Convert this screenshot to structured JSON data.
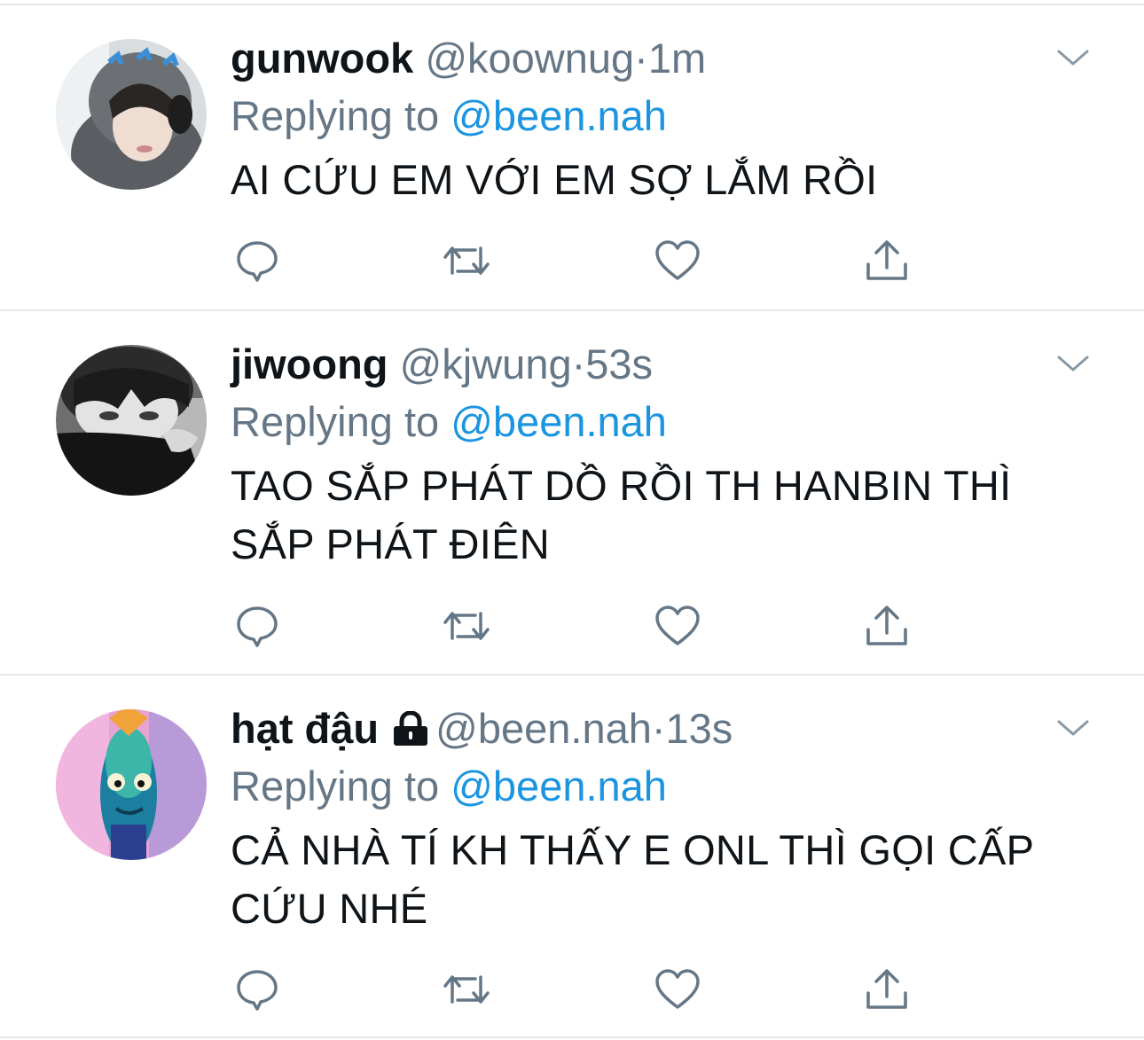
{
  "reply_label": "Replying to",
  "tweets": [
    {
      "display_name": "gunwook",
      "handle": "@koownug",
      "separator": "·",
      "time": "1m",
      "reply_to": "@been.nah",
      "text": "AI CỨU EM VỚI EM SỢ LẮM RỒI",
      "locked": false
    },
    {
      "display_name": "jiwoong",
      "handle": "@kjwung",
      "separator": "·",
      "time": "53s",
      "reply_to": "@been.nah",
      "text": "TAO SẮP PHÁT DỒ RỒI TH HANBIN THÌ SẮP PHÁT ĐIÊN",
      "locked": false
    },
    {
      "display_name": "hạt đậu",
      "handle": "@been.nah",
      "separator": "·",
      "time": "13s",
      "reply_to": "@been.nah",
      "text": "CẢ NHÀ TÍ KH THẤY E ONL THÌ GỌI CẤP CỨU NHÉ",
      "locked": true
    }
  ],
  "icons": {
    "reply": "reply-icon",
    "retweet": "retweet-icon",
    "like": "heart-icon",
    "share": "share-icon",
    "menu": "chevron-down-icon",
    "lock": "lock-icon"
  },
  "colors": {
    "link": "#1b95e0",
    "secondary_text": "#657786",
    "icon": "#657786",
    "divider": "#e1e8ed"
  }
}
